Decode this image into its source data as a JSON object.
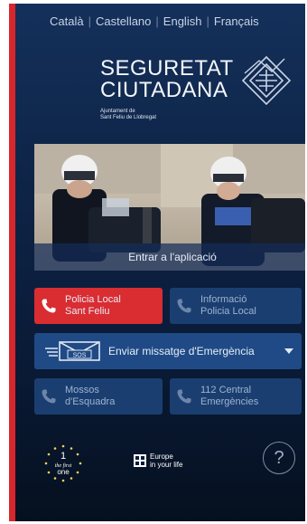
{
  "languages": [
    "Català",
    "Castellano",
    "English",
    "Français"
  ],
  "logo": {
    "line1": "SEGURETAT",
    "line2": "CIUTADANA",
    "sub1": "Ajuntament de",
    "sub2": "Sant Feliu de Llobregat"
  },
  "photo": {
    "enter_label": "Entrar a l'aplicació"
  },
  "buttons": {
    "police_local": {
      "line1": "Policia Local",
      "line2": "Sant Feliu"
    },
    "info_police": {
      "line1": "Informació",
      "line2": "Policia Local"
    },
    "emergency": {
      "label": "Enviar missatge d'Emergència",
      "envelope_text": "SOS"
    },
    "mossos": {
      "line1": "Mossos",
      "line2": "d'Esquadra"
    },
    "central112": {
      "line1": "112 Central",
      "line2": "Emergències"
    }
  },
  "footer": {
    "first_one_line1": "the first",
    "first_one_line2": "one",
    "first_one_number": "1",
    "europe_line1": "Europe",
    "europe_line2": "in your life",
    "help_symbol": "?"
  },
  "colors": {
    "accent_red": "#d92d32",
    "button_blue": "#1f4a86",
    "bg_dark": "#0a1a36"
  }
}
